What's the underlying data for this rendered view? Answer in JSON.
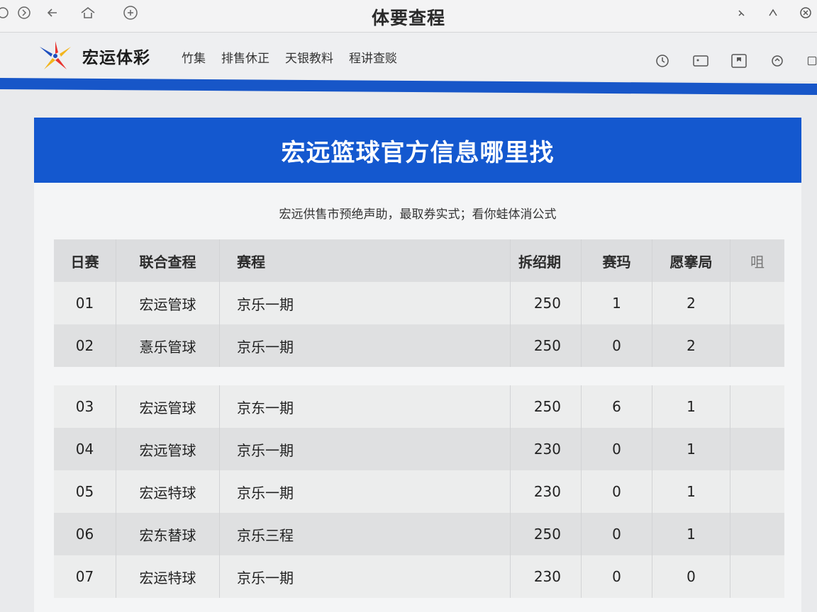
{
  "window": {
    "title": "体要查程",
    "left_icons": [
      "refresh-icon",
      "back-icon",
      "home-icon",
      "settings-icon"
    ],
    "right_icons": [
      "minimize-icon",
      "maximize-icon",
      "close-icon"
    ]
  },
  "header": {
    "brand": "宏运体彩",
    "nav": [
      "竹集",
      "排售休正",
      "天银教料",
      "程讲查赕"
    ],
    "icons": [
      "history-icon",
      "image-icon",
      "bookmark-icon",
      "refresh-icon",
      "more-icon"
    ]
  },
  "colors": {
    "accent": "#1458cf",
    "bar": "#1756c8"
  },
  "main": {
    "title": "宏远篮球官方信息哪里找",
    "subtitle": "宏远供售市预绝声助，最取券实式；看你蛙体消公式",
    "table": {
      "headers": [
        "日赛",
        "联合查程",
        "赛程",
        "拆绍期",
        "赛玛",
        "愿搴局",
        "咀"
      ],
      "rows": [
        {
          "no": "01",
          "team": "宏运管球",
          "schedule": "京乐一期",
          "period": "250",
          "score": "1",
          "result": "2"
        },
        {
          "no": "02",
          "team": "憙乐管球",
          "schedule": "京乐一期",
          "period": "250",
          "score": "0",
          "result": "2"
        },
        {
          "no": "03",
          "team": "宏运管球",
          "schedule": "京东一期",
          "period": "250",
          "score": "6",
          "result": "1"
        },
        {
          "no": "04",
          "team": "宏远管球",
          "schedule": "京乐一期",
          "period": "230",
          "score": "0",
          "result": "1"
        },
        {
          "no": "05",
          "team": "宏运特球",
          "schedule": "京乐一期",
          "period": "230",
          "score": "0",
          "result": "1"
        },
        {
          "no": "06",
          "team": "宏东替球",
          "schedule": "京乐三程",
          "period": "250",
          "score": "0",
          "result": "1"
        },
        {
          "no": "07",
          "team": "宏运特球",
          "schedule": "京乐一期",
          "period": "230",
          "score": "0",
          "result": "0"
        }
      ]
    }
  }
}
